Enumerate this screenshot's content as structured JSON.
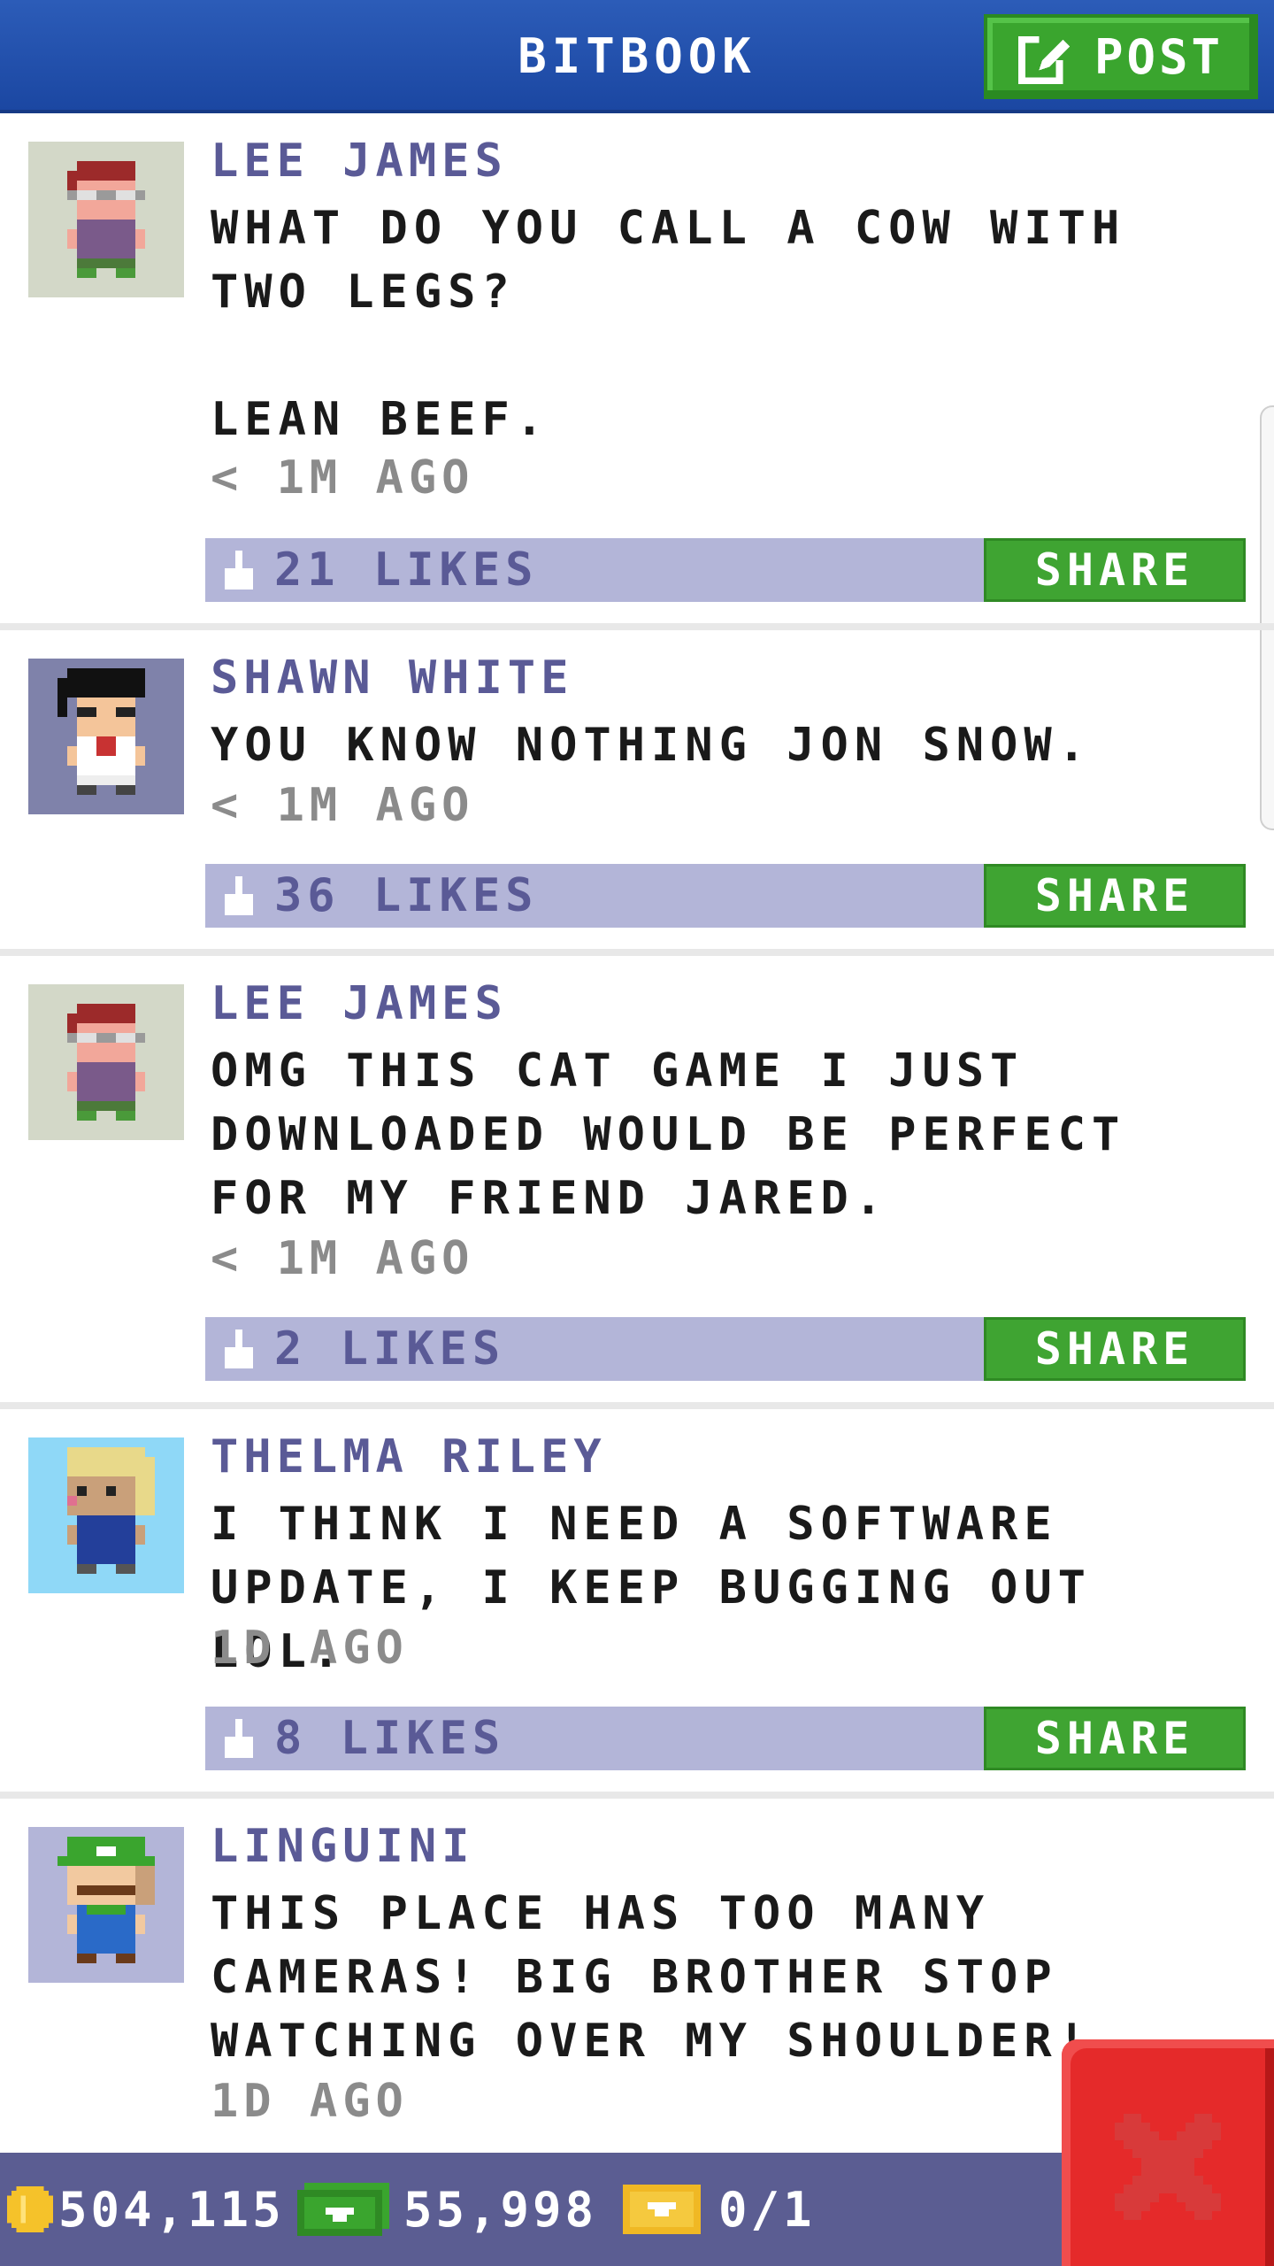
{
  "header": {
    "title": "BITBOOK",
    "post_label": "POST"
  },
  "posts": [
    {
      "author": "LEE JAMES",
      "message": "WHAT DO YOU CALL A COW WITH TWO LEGS?\n\nLEAN BEEF.",
      "time": "< 1M AGO",
      "likes": "21 LIKES",
      "share_label": "SHARE"
    },
    {
      "author": "SHAWN WHITE",
      "message": "YOU KNOW NOTHING JON SNOW.",
      "time": "< 1M AGO",
      "likes": "36 LIKES",
      "share_label": "SHARE"
    },
    {
      "author": "LEE JAMES",
      "message": "OMG THIS CAT GAME I JUST DOWNLOADED WOULD BE PERFECT FOR MY FRIEND JARED.",
      "time": "< 1M AGO",
      "likes": "2 LIKES",
      "share_label": "SHARE"
    },
    {
      "author": "THELMA RILEY",
      "message": "I THINK I NEED A SOFTWARE UPDATE, I KEEP BUGGING OUT LOL.",
      "time": "1D AGO",
      "likes": "8 LIKES",
      "share_label": "SHARE"
    },
    {
      "author": "LINGUINI",
      "message": "THIS PLACE HAS TOO MANY CAMERAS! BIG BROTHER STOP WATCHING OVER MY SHOULDER!",
      "time": "1D AGO"
    }
  ],
  "status": {
    "coins": "504,115",
    "bux": "55,998",
    "tickets": "0/1"
  },
  "colors": {
    "header": "#1b47a2",
    "accent_green": "#3fa432",
    "likes_bar": "#b3b5d8",
    "name_purple": "#5a5a96",
    "bottom_bar": "#5b5d92",
    "close_red": "#e52a2a"
  },
  "icons": [
    "edit-icon",
    "thumbs-up-icon",
    "coin-icon",
    "bux-icon",
    "ticket-icon",
    "close-icon"
  ]
}
